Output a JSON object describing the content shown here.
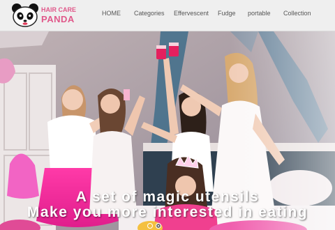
{
  "brand": {
    "line1": "HAIR CARE",
    "line2": "PANDA",
    "color": "#e0588a"
  },
  "nav": {
    "items": [
      "HOME",
      "Categories",
      "Effervescent",
      "Fudge",
      "portable",
      "Collection"
    ]
  },
  "hero": {
    "caption_line1": "A set of magic utensils",
    "caption_line2": "Make you more interested in eating",
    "slide_count": 2,
    "active_slide": 2
  }
}
